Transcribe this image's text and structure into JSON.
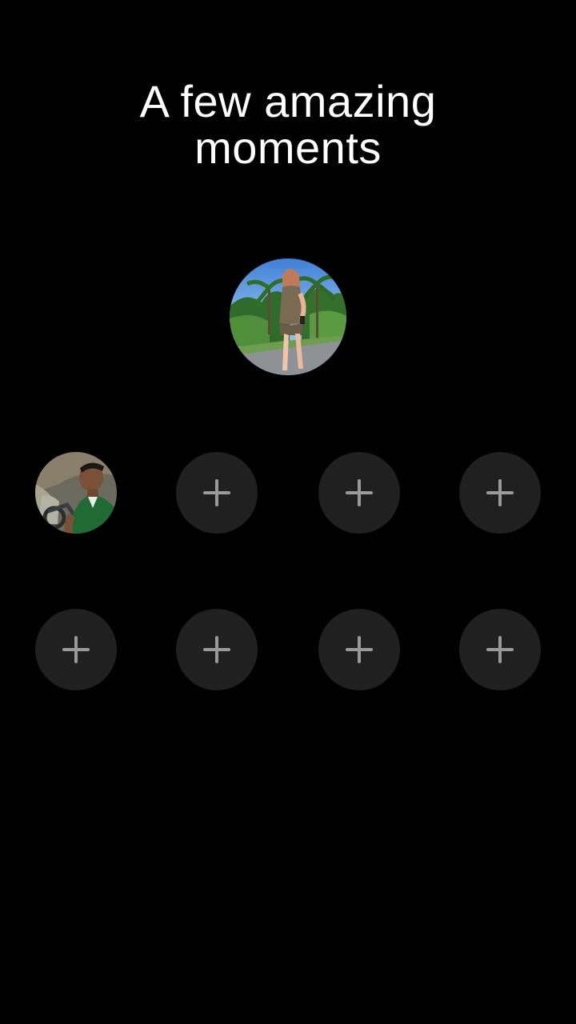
{
  "title": {
    "line1": "A few amazing",
    "line2": "moments"
  },
  "featured_moment": {
    "icon": "photo-avatar-woman"
  },
  "slots": [
    {
      "filled": true,
      "icon": "photo-avatar-man"
    },
    {
      "filled": false,
      "icon": "plus-icon"
    },
    {
      "filled": false,
      "icon": "plus-icon"
    },
    {
      "filled": false,
      "icon": "plus-icon"
    },
    {
      "filled": false,
      "icon": "plus-icon"
    },
    {
      "filled": false,
      "icon": "plus-icon"
    },
    {
      "filled": false,
      "icon": "plus-icon"
    },
    {
      "filled": false,
      "icon": "plus-icon"
    }
  ],
  "colors": {
    "background": "#000000",
    "slot_background": "#202020",
    "plus": "#9a9a9a",
    "title": "#ffffff"
  }
}
